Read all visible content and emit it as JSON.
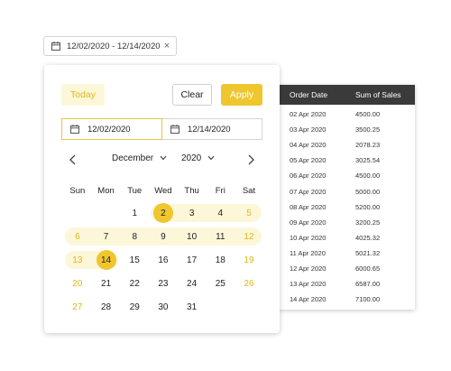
{
  "range_input": {
    "value": "12/02/2020 - 12/14/2020",
    "clear_glyph": "×",
    "icon": "calendar-icon"
  },
  "popup": {
    "today_label": "Today",
    "clear_label": "Clear",
    "apply_label": "Apply",
    "start_date": "12/02/2020",
    "end_date": "12/14/2020",
    "month": "December",
    "year": "2020",
    "weekdays": [
      "Sun",
      "Mon",
      "Tue",
      "Wed",
      "Thu",
      "Fri",
      "Sat"
    ],
    "weeks": [
      [
        "",
        "",
        "1",
        "2",
        "3",
        "4",
        "5"
      ],
      [
        "6",
        "7",
        "8",
        "9",
        "10",
        "11",
        "12"
      ],
      [
        "13",
        "14",
        "15",
        "16",
        "17",
        "18",
        "19"
      ],
      [
        "20",
        "21",
        "22",
        "23",
        "24",
        "25",
        "26"
      ],
      [
        "27",
        "28",
        "29",
        "30",
        "31",
        "",
        ""
      ]
    ],
    "range_start": "2",
    "range_end": "14",
    "accent": "#efc62e",
    "range_bg": "#fdf7d9",
    "weekend_color": "#e2b615"
  },
  "table": {
    "headers": [
      "Order Date",
      "Sum of Sales"
    ],
    "rows": [
      [
        "02 Apr 2020",
        "4500.00"
      ],
      [
        "03 Apr 2020",
        "3500.25"
      ],
      [
        "04 Apr 2020",
        "2078.23"
      ],
      [
        "05 Apr 2020",
        "3025.54"
      ],
      [
        "06 Apr 2020",
        "4500.00"
      ],
      [
        "07 Apr 2020",
        "5000.00"
      ],
      [
        "08 Apr 2020",
        "5200.00"
      ],
      [
        "09 Apr 2020",
        "3200.25"
      ],
      [
        "10 Apr 2020",
        "4025.32"
      ],
      [
        "11 Apr 2020",
        "5021.32"
      ],
      [
        "12 Apr 2020",
        "6000.65"
      ],
      [
        "13 Apr 2020",
        "6587.00"
      ],
      [
        "14 Apr 2020",
        "7100.00"
      ]
    ]
  }
}
